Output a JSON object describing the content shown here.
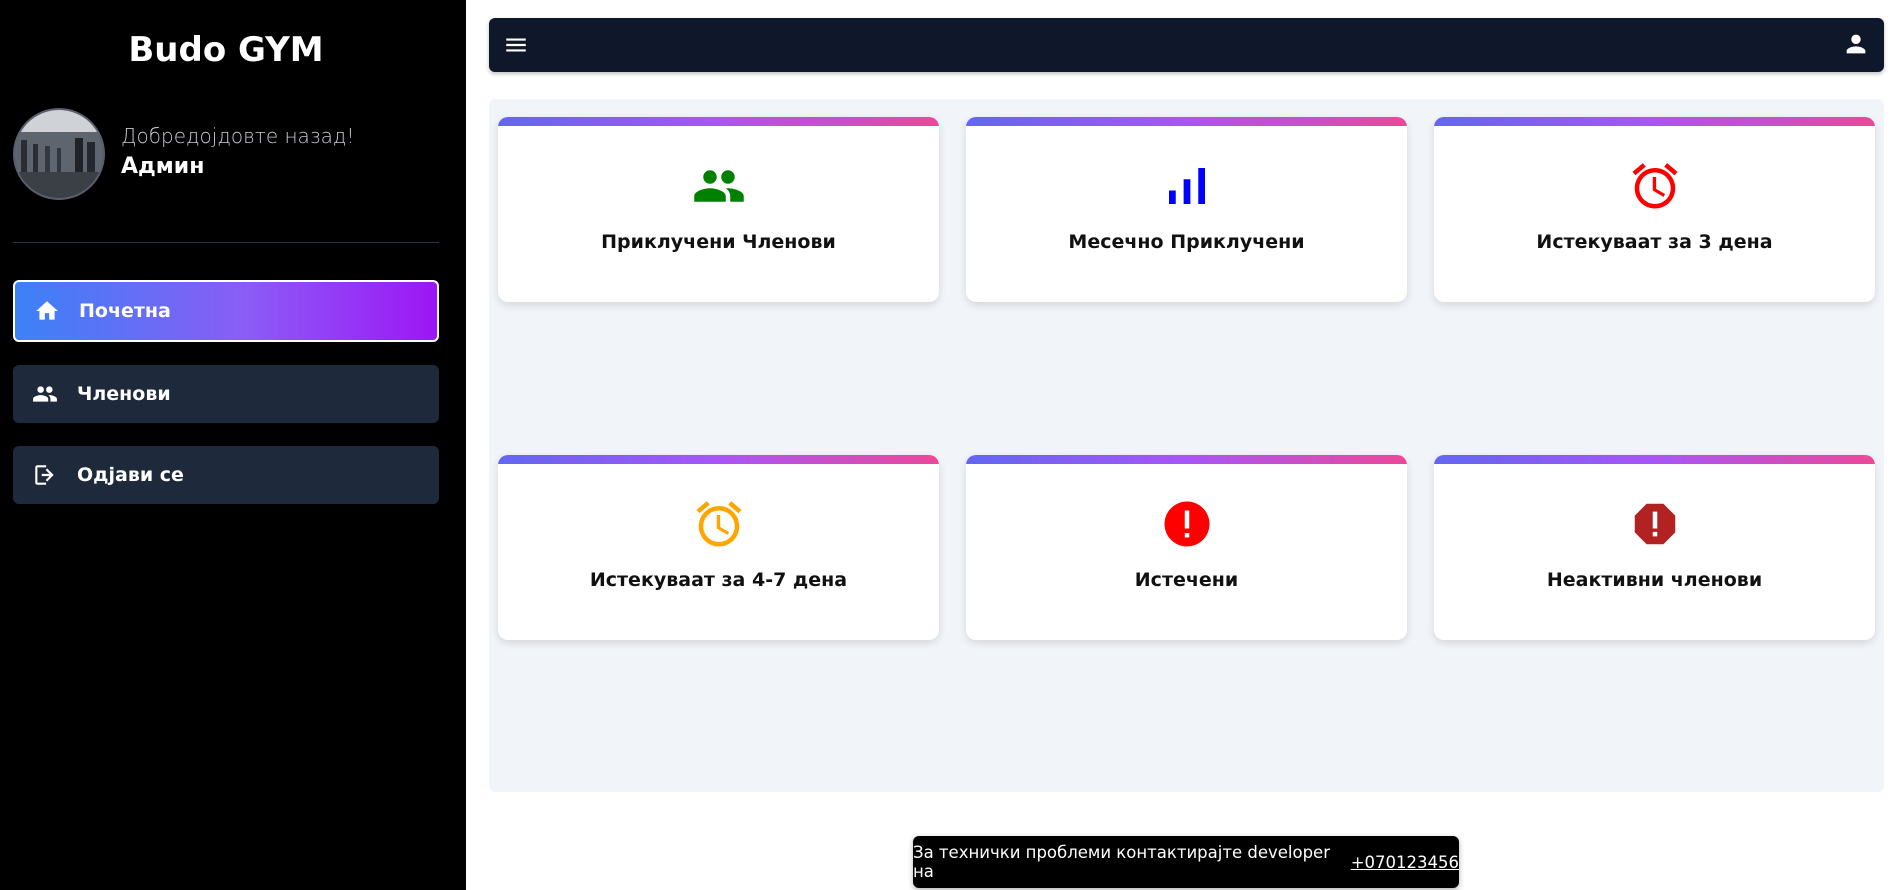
{
  "sidebar": {
    "brand": "Budo GYM",
    "welcome": "Добредојдовте назад!",
    "username": "Админ",
    "items": [
      {
        "label": "Почетна",
        "icon": "home-icon",
        "active": true
      },
      {
        "label": "Членови",
        "icon": "people-icon",
        "active": false
      },
      {
        "label": "Одјави се",
        "icon": "logout-icon",
        "active": false
      }
    ]
  },
  "topbar": {
    "menu_icon": "hamburger-menu-icon",
    "user_icon": "user-icon"
  },
  "cards": [
    {
      "title": "Приклучени Членови",
      "icon": "people-icon",
      "color": "#008000"
    },
    {
      "title": "Месечно Приклучени",
      "icon": "bar-chart-icon",
      "color": "#0000ff"
    },
    {
      "title": "Истекуваат за 3 дена",
      "icon": "alarm-clock-icon",
      "color": "#ff0000"
    },
    {
      "title": "Истекуваат за 4-7 дена",
      "icon": "alarm-clock-icon",
      "color": "#ffa500"
    },
    {
      "title": "Истечени",
      "icon": "error-circle-icon",
      "color": "#ff0000"
    },
    {
      "title": "Неактивни членови",
      "icon": "error-octagon-icon",
      "color": "#b22222"
    }
  ],
  "footer": {
    "text": "За технички проблеми контактирајте developer на",
    "phone": "+070123456"
  },
  "colors": {
    "sidebar_bg": "#000000",
    "nav_bg": "#1e293b",
    "topbar_bg": "#0f172a",
    "content_bg": "#f1f4f8"
  }
}
